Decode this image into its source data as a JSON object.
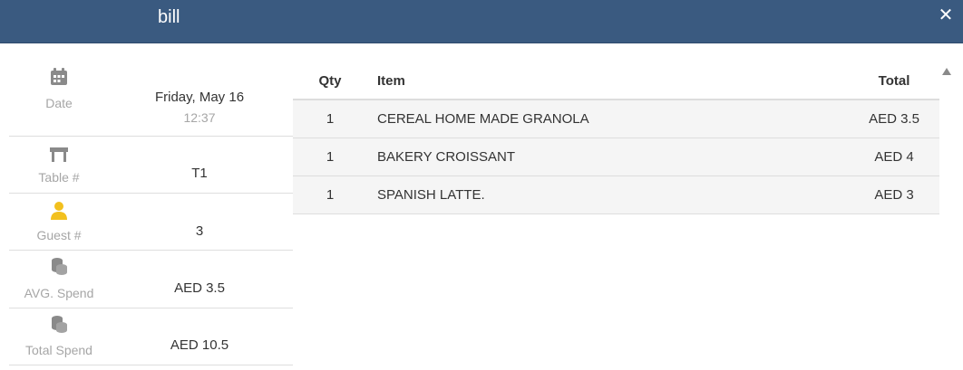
{
  "header": {
    "title": "bill",
    "close_label": "✕"
  },
  "info": {
    "date_label": "Date",
    "date_value": "Friday, May 16",
    "time_value": "12:37",
    "table_label": "Table #",
    "table_value": "T1",
    "guest_label": "Guest #",
    "guest_value": "3",
    "avg_label": "AVG. Spend",
    "avg_value": "AED 3.5",
    "total_label": "Total Spend",
    "total_value": "AED 10.5"
  },
  "items_table": {
    "headers": {
      "qty": "Qty",
      "item": "Item",
      "total": "Total"
    },
    "rows": [
      {
        "qty": "1",
        "item": "CEREAL HOME MADE GRANOLA",
        "total": "AED 3.5"
      },
      {
        "qty": "1",
        "item": "BAKERY CROISSANT",
        "total": "AED 4"
      },
      {
        "qty": "1",
        "item": "SPANISH LATTE.",
        "total": "AED 3"
      }
    ]
  },
  "icons": {
    "date": "calendar-icon",
    "table": "table-icon",
    "guest": "person-icon",
    "avg": "coins-icon",
    "total": "coins-icon"
  },
  "colors": {
    "header_bg": "#3a5a80",
    "icon_gray": "#8a8a8a",
    "guest_icon": "#f2c01e"
  }
}
